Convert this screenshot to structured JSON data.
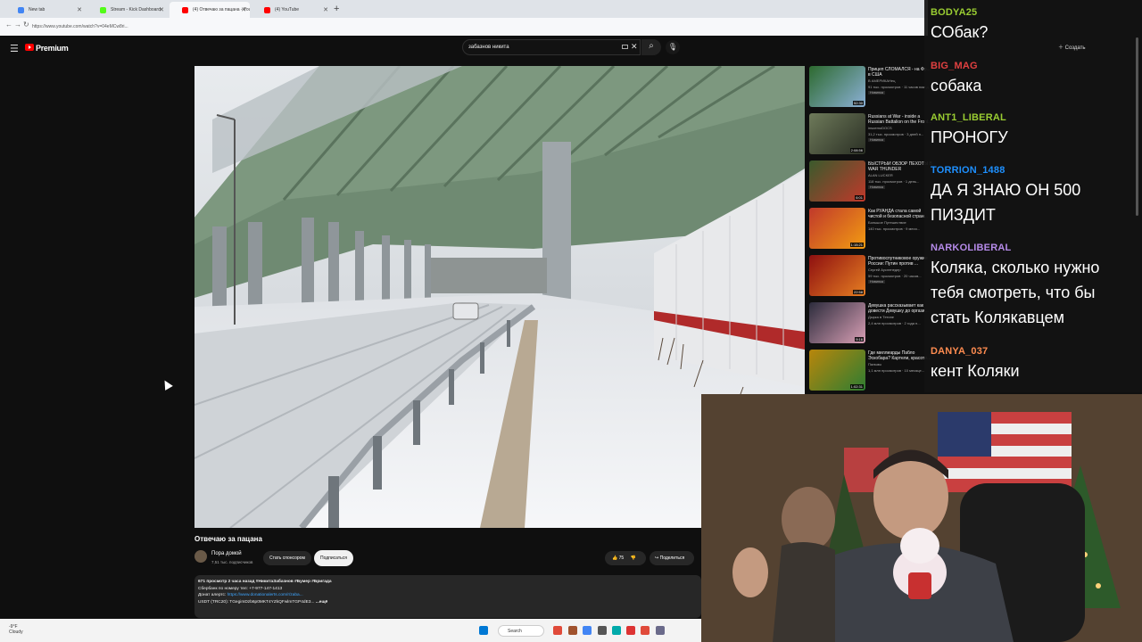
{
  "browser": {
    "tabs": [
      {
        "label": "New tab",
        "color": "#4285f4"
      },
      {
        "label": "Stream - Kick Dashboard",
        "color": "#53fc18"
      },
      {
        "label": "(4) Отвечаю за пацана - YouTube",
        "color": "#ff0000"
      },
      {
        "label": "(4) YouTube",
        "color": "#ff0000"
      }
    ],
    "url": "https://www.youtube.com/watch?v=04eMCw8ri..."
  },
  "youtube": {
    "logo_text": "Premium",
    "search_value": "забазнов никита",
    "video": {
      "title": "Отвечаю за пацана",
      "channel": "Пора домой",
      "subscribers": "7,51 тыс. подписчиков",
      "sponsor_label": "Стать спонсором",
      "subscribe_label": "Подписаться",
      "likes": "75",
      "share_label": "Поделиться",
      "description": {
        "meta": "671 просмотр  2 часа назад  #НикитаЗабазнов #Бумер #Бригада",
        "line2": "Сбербанк по номеру тел: +7-977-147-1413",
        "line3_prefix": "Донат алертс: ",
        "line3_link": "https://www.donationalerts.com/r/zaba...",
        "line4": "USDT (TRC20): TGegimDzb6p0MKT4YZkQFwlmTGP4dE3...",
        "more": "...ещё"
      }
    },
    "related": [
      {
        "title": "Прицеп СЛОМАЛСЯ - на Фр... в США",
        "channel": "В АМЕРИКАНец",
        "views": "91 тыс. просмотров · 11 часов назад",
        "badge": "Новинка",
        "duration": "52:30",
        "colors": [
          "#2d6a2f",
          "#8bb0d6"
        ]
      },
      {
        "title": "Russians at War - inside a Russian Battalion on the Front...",
        "channel": "insoemoDOCS",
        "views": "31,2 тыс. просмотров · 3 дней н...",
        "badge": "Новинка",
        "duration": "2:08:56",
        "colors": [
          "#6e7a5a",
          "#2a2f24"
        ]
      },
      {
        "title": "БЫСТРЫЙ ОБЗОР ПЕХОТЫ В WAR THUNDER",
        "channel": "ALAN LUCKER",
        "views": "118 тыс. просмотров · 1 день...",
        "badge": "Новинка",
        "duration": "6:01",
        "colors": [
          "#3a5a2c",
          "#c0392b"
        ]
      },
      {
        "title": "Как РУАНДА стала самой чистой и безопасной стран...",
        "channel": "Большое Путешествие",
        "views": "140 тыс. просмотров · 9 меся...",
        "badge": "",
        "duration": "1:15:21",
        "colors": [
          "#c0392b",
          "#f39c12"
        ]
      },
      {
        "title": "Противоспутниковое оружие России: Путин против ...",
        "channel": "Сергей Аусленедер",
        "views": "59 тыс. просмотров · 20 часов...",
        "badge": "Новинка",
        "duration": "22:58",
        "colors": [
          "#8e1010",
          "#e67e22"
        ]
      },
      {
        "title": "Девушка рассказывает как довести Девушку до оргази...",
        "channel": "Дырка в Тетине",
        "views": "2,4 млн просмотров · 2 года н...",
        "badge": "",
        "duration": "9:16",
        "colors": [
          "#2c2c3c",
          "#d99fb5"
        ]
      },
      {
        "title": "Где миллиарды Пабло Эскобара? Картели, красоте...",
        "channel": "Пальмы",
        "views": "1,1 млн просмотров · 10 месяце...",
        "badge": "",
        "duration": "1:02:31",
        "colors": [
          "#b8860b",
          "#2e7d32"
        ]
      }
    ],
    "create_label": "Создать"
  },
  "chat": [
    {
      "user": "BODYA25",
      "text": "СОбак?",
      "color": "#9acd32"
    },
    {
      "user": "BIG_MAG",
      "text": "собака",
      "color": "#e04040"
    },
    {
      "user": "ANT1_LIBERAL",
      "text": "ПРОНОГУ",
      "color": "#9acd32"
    },
    {
      "user": "TORRION_1488",
      "text": "ДА Я ЗНАЮ ОН 500 ПИЗДИТ",
      "color": "#1e90ff"
    },
    {
      "user": "NARKOLIBERAL",
      "text": "Коляка, сколько нужно тебя смотреть, что бы стать Колякавцем",
      "color": "#b58ae8"
    },
    {
      "user": "DANYA_037",
      "text": "кент Коляки",
      "color": "#ff8c50"
    }
  ],
  "taskbar": {
    "weather_temp": "-9°F",
    "weather_desc": "Cloudy",
    "search_label": "Search"
  }
}
